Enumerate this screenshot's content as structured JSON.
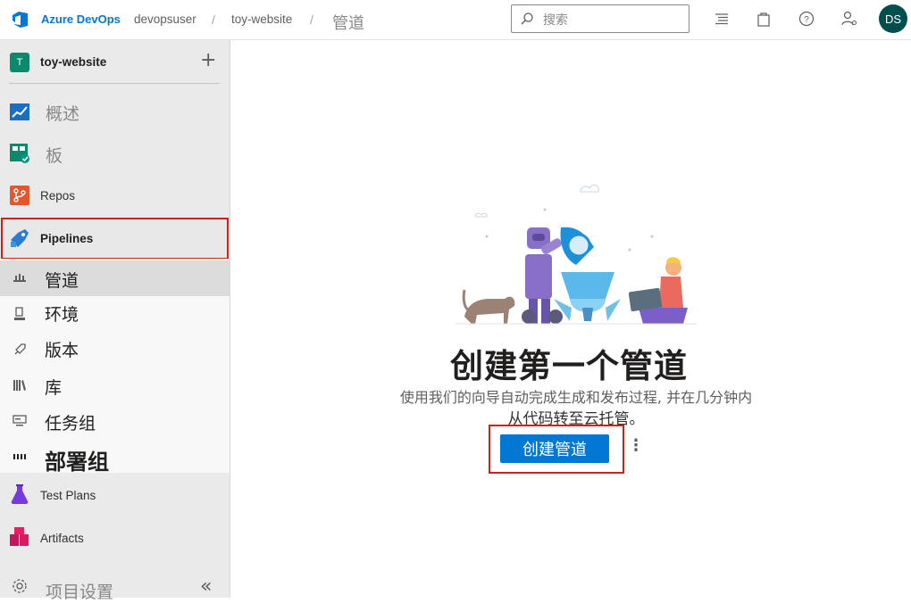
{
  "header": {
    "brand": "Azure DevOps",
    "org": "devopsuser",
    "sep1": "/",
    "project": "toy-website",
    "sep2": "/",
    "page": "管道",
    "search_placeholder": "搜索",
    "avatar_initials": "DS"
  },
  "sidebar": {
    "project_badge": "T",
    "project_name": "toy-website",
    "items": [
      {
        "label": "概述",
        "icon": "overview-icon"
      },
      {
        "label": "板",
        "icon": "boards-icon"
      },
      {
        "label": "Repos",
        "icon": "repos-icon"
      },
      {
        "label": "Pipelines",
        "icon": "pipelines-icon"
      }
    ],
    "pipeline_sub": [
      {
        "label": "管道",
        "icon": "pipeline-sub-icon"
      },
      {
        "label": "环境",
        "icon": "environment-icon"
      },
      {
        "label": "版本",
        "icon": "release-icon"
      },
      {
        "label": "库",
        "icon": "library-icon"
      },
      {
        "label": "任务组",
        "icon": "task-group-icon"
      },
      {
        "label": "部署组",
        "icon": "deployment-group-icon"
      }
    ],
    "bottom_items": [
      {
        "label": "Test Plans",
        "icon": "test-plans-icon"
      },
      {
        "label": "Artifacts",
        "icon": "artifacts-icon"
      },
      {
        "label": "项目设置",
        "icon": "gear-icon"
      }
    ]
  },
  "main": {
    "title": "创建第一个管道",
    "desc_line1": "使用我们的向导自动完成生成和发布过程, 并在几分钟内",
    "desc_line2": "从代码转至云托管。",
    "cta_label": "创建管道"
  },
  "colors": {
    "brand": "#0078d4",
    "highlight_border": "#d0201a",
    "avatar_bg": "#004e4e",
    "project_badge_bg": "#0b8a6b"
  }
}
